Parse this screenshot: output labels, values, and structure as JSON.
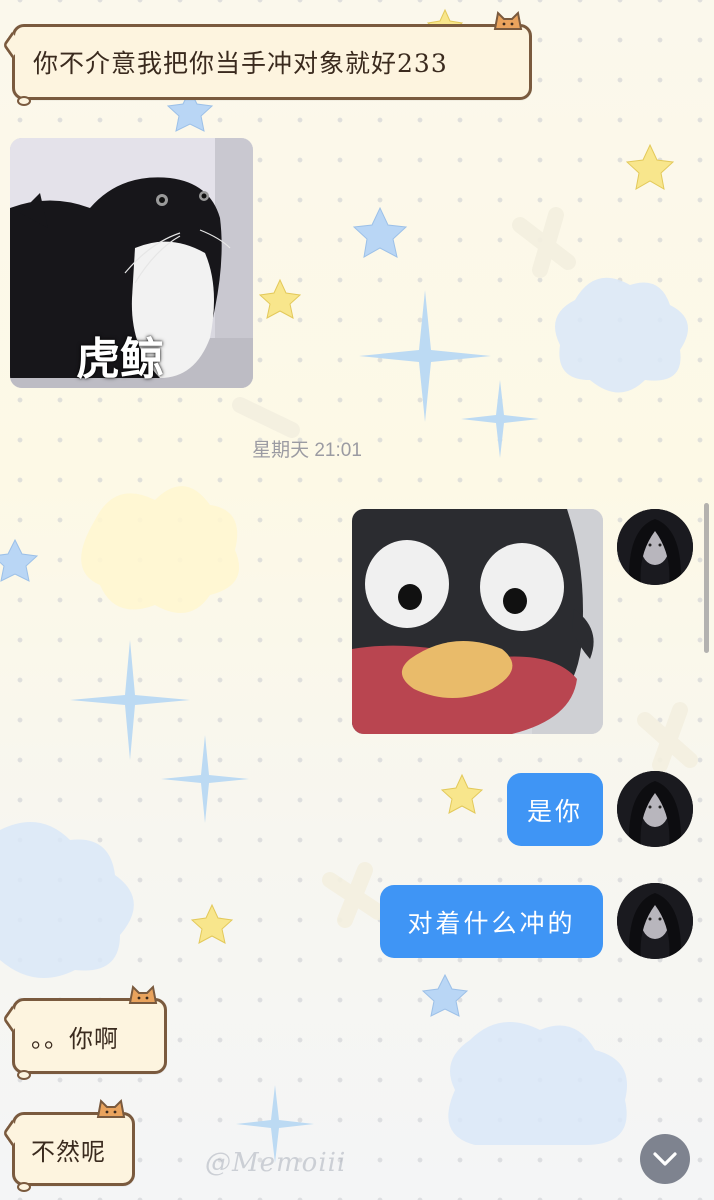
{
  "messages": {
    "recv1": {
      "text": "你不介意我把你当手冲对象就好233"
    },
    "recv_image_caption": "虎鲸",
    "timestamp": "星期天 21:01",
    "sent1": {
      "text": "是你"
    },
    "sent2": {
      "text": "对着什么冲的"
    },
    "recv2": {
      "text": "。。你啊"
    },
    "recv3": {
      "text": "不然呢"
    }
  },
  "watermark": "@Memoiii",
  "colors": {
    "sent_bubble": "#3f95f5",
    "cat_bubble_bg": "#fdf4df",
    "cat_bubble_border": "#7a5a3e",
    "background": "#fbf8ec"
  },
  "icons": {
    "scroll_down": "chevron-down-icon"
  }
}
